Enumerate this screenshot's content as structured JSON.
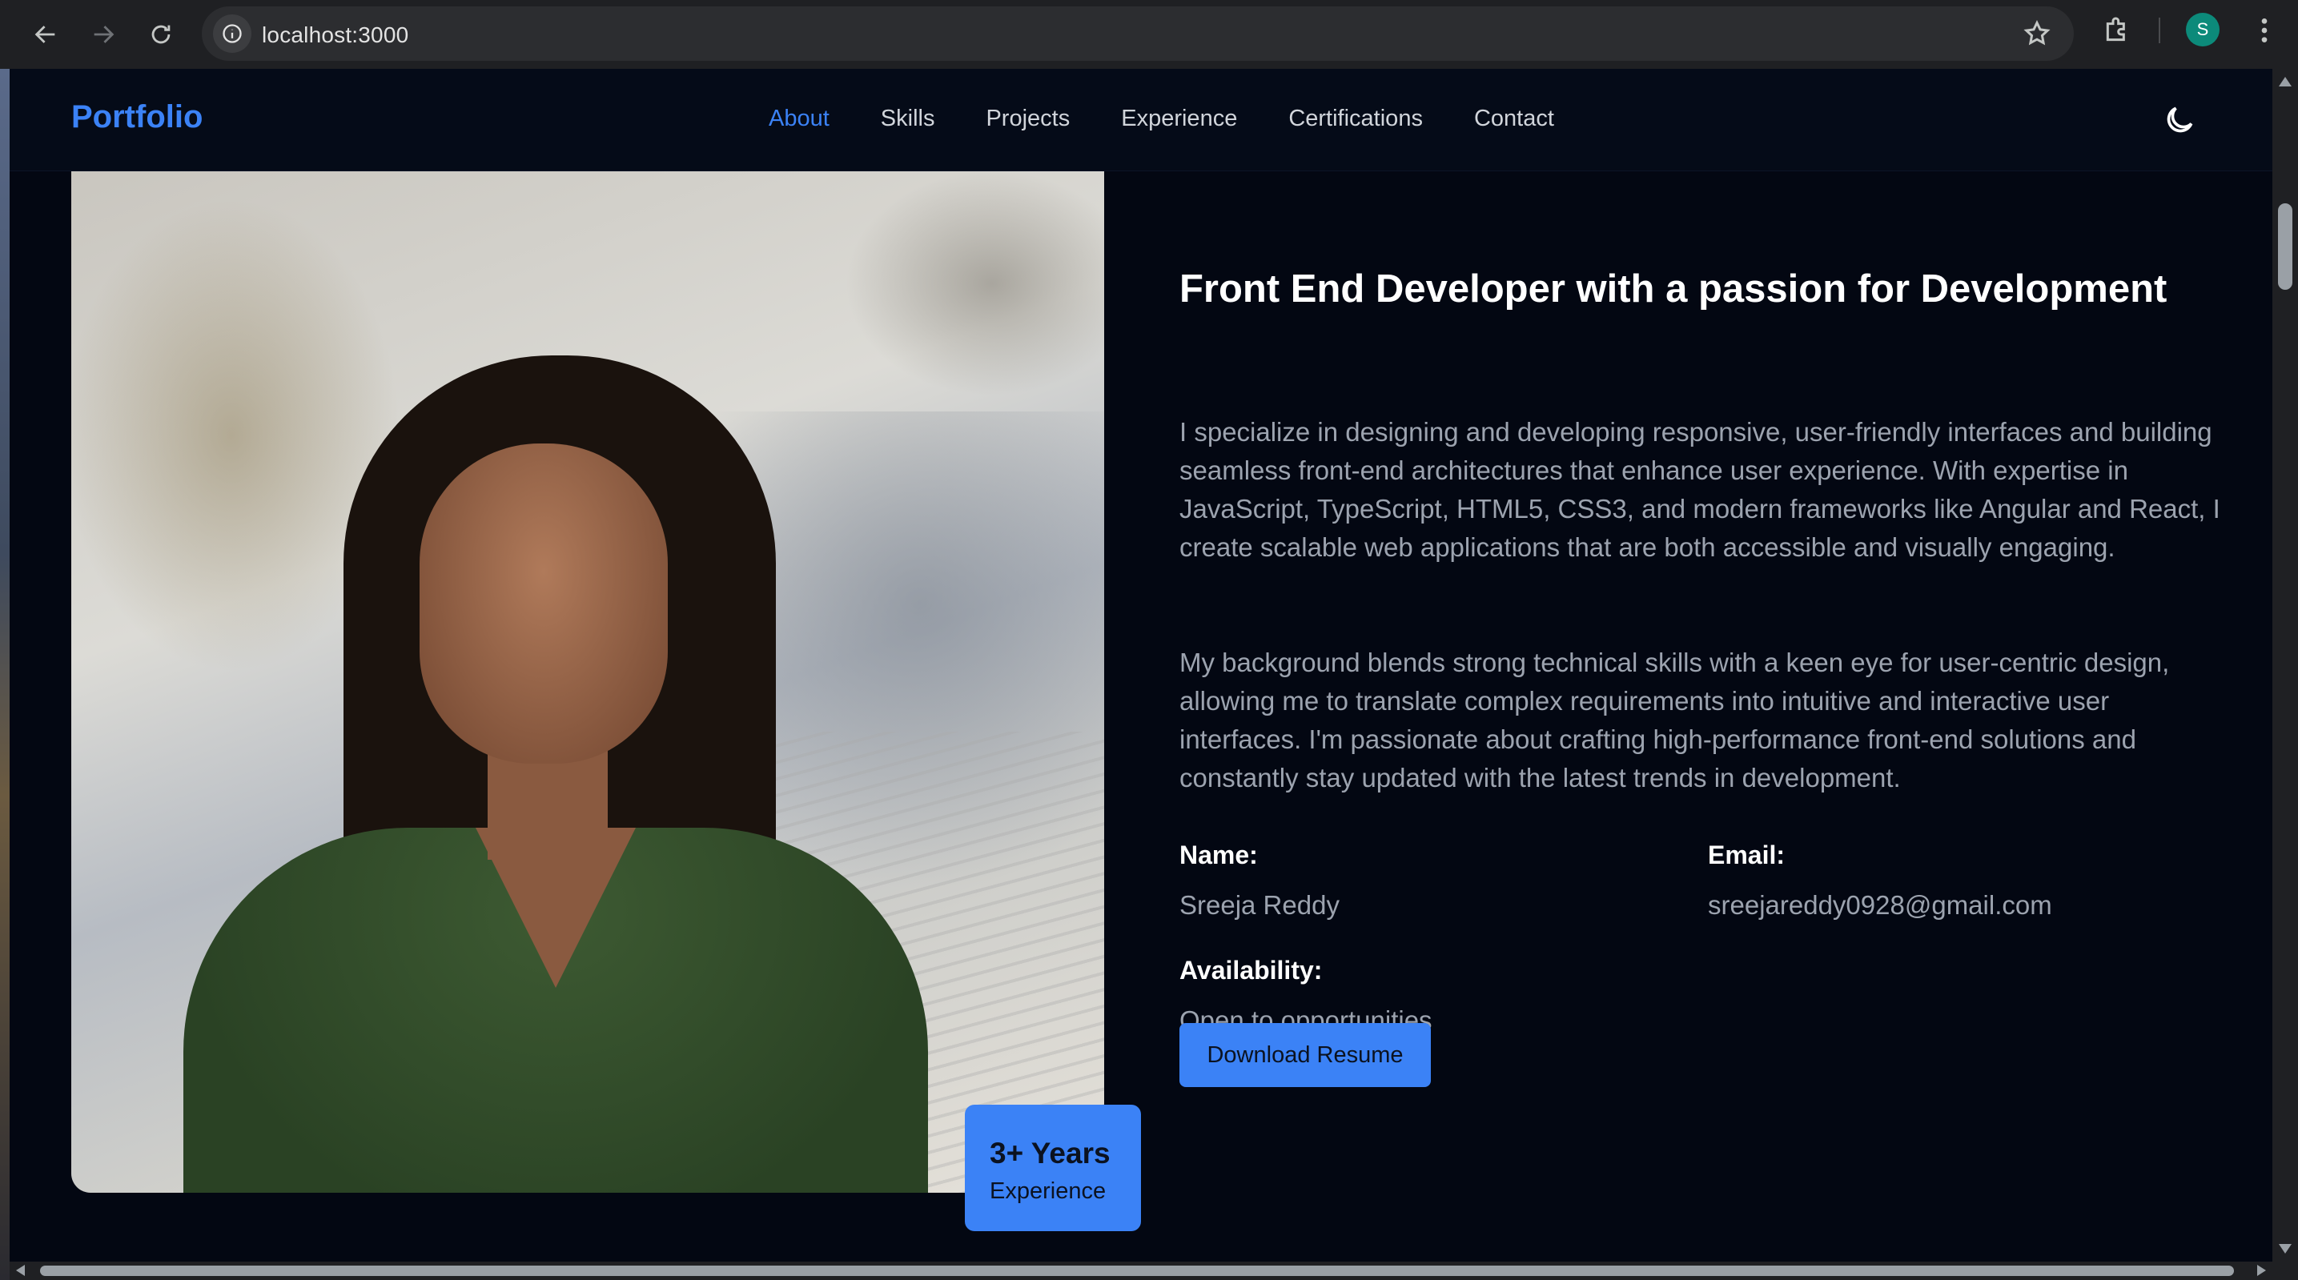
{
  "browser": {
    "url": "localhost:3000",
    "profile_initial": "S",
    "icons": {
      "back": "back-arrow-icon",
      "forward": "forward-arrow-icon",
      "reload": "reload-icon",
      "site_info": "info-icon",
      "bookmark": "star-icon",
      "extensions": "puzzle-icon",
      "menu": "kebab-menu-icon"
    }
  },
  "header": {
    "brand": "Portfolio",
    "nav": [
      {
        "label": "About",
        "active": true
      },
      {
        "label": "Skills",
        "active": false
      },
      {
        "label": "Projects",
        "active": false
      },
      {
        "label": "Experience",
        "active": false
      },
      {
        "label": "Certifications",
        "active": false
      },
      {
        "label": "Contact",
        "active": false
      }
    ],
    "theme_toggle_icon": "moon-icon"
  },
  "about": {
    "badge": {
      "big": "3+ Years",
      "small": "Experience"
    },
    "title": "Front End Developer with a passion for Development",
    "paragraph1": "I specialize in designing and developing responsive, user-friendly interfaces and building seamless front-end architectures that enhance user experience. With expertise in JavaScript, TypeScript, HTML5, CSS3, and modern frameworks like Angular and React, I create scalable web applications that are both accessible and visually engaging.",
    "paragraph2": "My background blends strong technical skills with a keen eye for user-centric design, allowing me to translate complex requirements into intuitive and interactive user interfaces. I'm passionate about crafting high-performance front-end solutions and constantly stay updated with the latest trends in development.",
    "name_label": "Name:",
    "name_value": "Sreeja Reddy",
    "email_label": "Email:",
    "email_value": "sreejareddy0928@gmail.com",
    "availability_label": "Availability:",
    "availability_value": "Open to opportunities",
    "download_label": "Download Resume"
  },
  "colors": {
    "accent": "#3b82f6",
    "page_bg": "#030712",
    "header_bg": "#050b18",
    "muted_text": "#9ca3af"
  }
}
